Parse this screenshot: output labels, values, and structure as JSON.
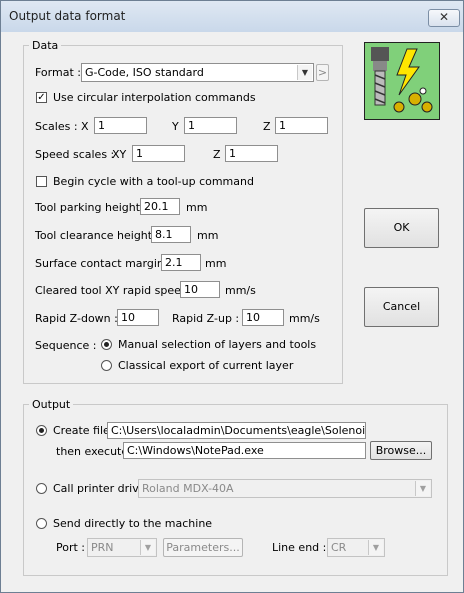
{
  "window": {
    "title": "Output data format",
    "close_symbol": "✕"
  },
  "data_group": {
    "legend": "Data",
    "format_label": "Format :",
    "format_value": "G-Code, ISO standard",
    "format_more": ">",
    "circular_label": "Use circular interpolation commands",
    "circular_checked": true,
    "scales_label": "Scales :",
    "scale_x_label": "X",
    "scale_x_value": "1",
    "scale_y_label": "Y",
    "scale_y_value": "1",
    "scale_z_label": "Z",
    "scale_z_value": "1",
    "speed_scales_label": "Speed scales :",
    "speed_xy_label": "XY",
    "speed_xy_value": "1",
    "speed_z_label": "Z",
    "speed_z_value": "1",
    "tool_up_label": "Begin cycle with a tool-up command",
    "tool_up_checked": false,
    "parking_label": "Tool parking height :",
    "parking_value": "20.1",
    "parking_unit": "mm",
    "clearance_label": "Tool clearance height :",
    "clearance_value": "8.1",
    "clearance_unit": "mm",
    "contact_label": "Surface contact margin :",
    "contact_value": "2.1",
    "contact_unit": "mm",
    "rapid_label": "Cleared tool XY rapid speed :",
    "rapid_value": "10",
    "rapid_unit": "mm/s",
    "zdown_label": "Rapid Z-down :",
    "zdown_value": "10",
    "zup_label": "Rapid Z-up :",
    "zup_value": "10",
    "zup_unit": "mm/s",
    "sequence_label": "Sequence :",
    "sequence_opt1": "Manual selection of layers and tools",
    "sequence_opt2": "Classical export of current layer",
    "sequence_selected": 1
  },
  "buttons": {
    "ok": "OK",
    "cancel": "Cancel"
  },
  "output_group": {
    "legend": "Output",
    "create_file_label": "Create file",
    "create_file_path": "C:\\Users\\localadmin\\Documents\\eagle\\SolenoidDrive",
    "then_execute_label": "then execute",
    "execute_path": "C:\\Windows\\NotePad.exe",
    "browse_label": "Browse...",
    "printer_label": "Call printer driver",
    "printer_value": "Roland MDX-40A",
    "send_label": "Send directly to the machine",
    "port_label": "Port :",
    "port_value": "PRN",
    "parameters_label": "Parameters...",
    "line_end_label": "Line end :",
    "line_end_value": "CR",
    "selected": "create_file"
  },
  "colors": {
    "logo_bg": "#80d07a",
    "bolt": "#ffe600",
    "gear": "#d8b000"
  }
}
